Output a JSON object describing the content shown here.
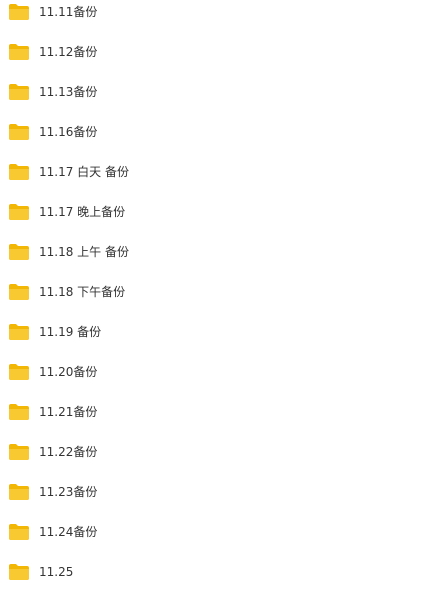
{
  "folder_color": "#F8C930",
  "folder_tab_color": "#F2B705",
  "text_color": "#333333",
  "folders": [
    {
      "name": "11.11备份",
      "icon": "folder-icon"
    },
    {
      "name": "11.12备份",
      "icon": "folder-icon"
    },
    {
      "name": "11.13备份",
      "icon": "folder-icon"
    },
    {
      "name": "11.16备份",
      "icon": "folder-icon"
    },
    {
      "name": "11.17 白天 备份",
      "icon": "folder-icon"
    },
    {
      "name": "11.17 晚上备份",
      "icon": "folder-icon"
    },
    {
      "name": "11.18 上午 备份",
      "icon": "folder-icon"
    },
    {
      "name": "11.18 下午备份",
      "icon": "folder-icon"
    },
    {
      "name": "11.19 备份",
      "icon": "folder-icon"
    },
    {
      "name": "11.20备份",
      "icon": "folder-icon"
    },
    {
      "name": "11.21备份",
      "icon": "folder-icon"
    },
    {
      "name": "11.22备份",
      "icon": "folder-icon"
    },
    {
      "name": "11.23备份",
      "icon": "folder-icon"
    },
    {
      "name": "11.24备份",
      "icon": "folder-icon"
    },
    {
      "name": "11.25",
      "icon": "folder-icon"
    }
  ]
}
